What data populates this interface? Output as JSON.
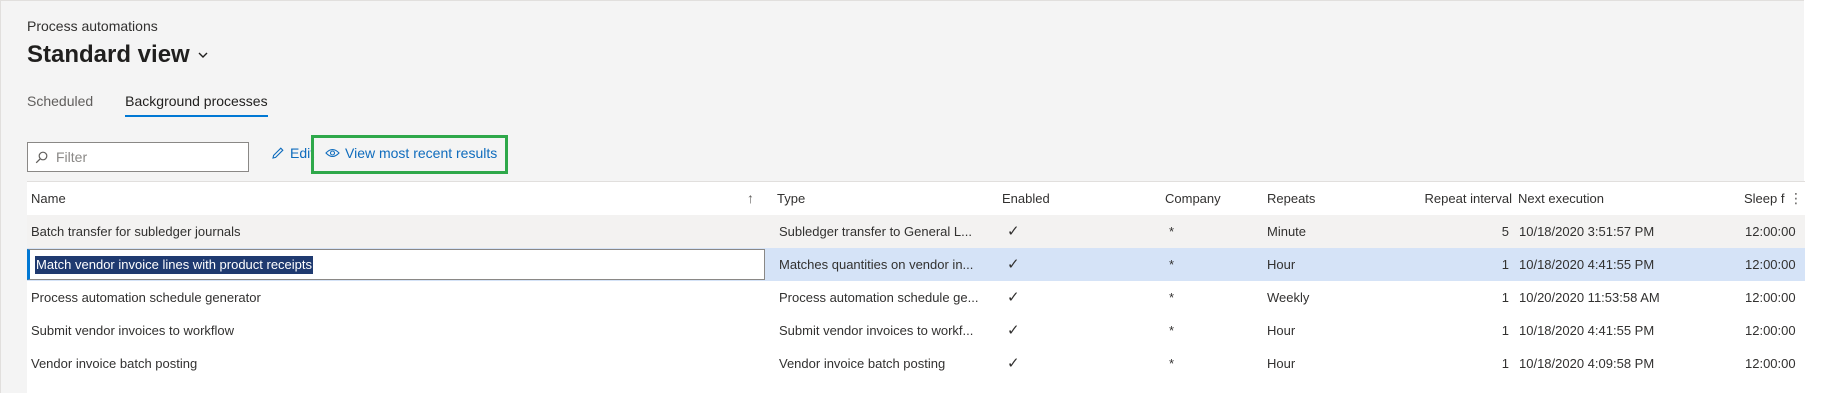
{
  "header": {
    "caption": "Process automations",
    "view_name": "Standard view"
  },
  "tabs": [
    {
      "label": "Scheduled",
      "active": false
    },
    {
      "label": "Background processes",
      "active": true
    }
  ],
  "toolbar": {
    "filter_placeholder": "Filter",
    "edit_label": "Edit",
    "view_results_label": "View most recent results"
  },
  "colors": {
    "accent": "#0078d4",
    "highlight_box": "#2ea84a",
    "check": "#107c10",
    "selected_row": "#d5e3f7"
  },
  "grid": {
    "columns": [
      "Name",
      "Type",
      "Enabled",
      "Company",
      "Repeats",
      "Repeat interval",
      "Next execution",
      "Sleep f"
    ],
    "sort_indicator": "↑",
    "rows": [
      {
        "name": "Batch transfer for subledger journals",
        "type": "Subledger transfer to General L...",
        "enabled": "✓",
        "company": "*",
        "repeats": "Minute",
        "interval": "5",
        "next": "10/18/2020 3:51:57 PM",
        "sleep": "12:00:00"
      },
      {
        "name": "Match vendor invoice lines with product receipts",
        "type": "Matches quantities on vendor in...",
        "enabled": "✓",
        "company": "*",
        "repeats": "Hour",
        "interval": "1",
        "next": "10/18/2020 4:41:55 PM",
        "sleep": "12:00:00"
      },
      {
        "name": "Process automation schedule generator",
        "type": "Process automation schedule ge...",
        "enabled": "✓",
        "company": "*",
        "repeats": "Weekly",
        "interval": "1",
        "next": "10/20/2020 11:53:58 AM",
        "sleep": "12:00:00"
      },
      {
        "name": "Submit vendor invoices to workflow",
        "type": "Submit vendor invoices to workf...",
        "enabled": "✓",
        "company": "*",
        "repeats": "Hour",
        "interval": "1",
        "next": "10/18/2020 4:41:55 PM",
        "sleep": "12:00:00"
      },
      {
        "name": "Vendor invoice batch posting",
        "type": "Vendor invoice batch posting",
        "enabled": "✓",
        "company": "*",
        "repeats": "Hour",
        "interval": "1",
        "next": "10/18/2020 4:09:58 PM",
        "sleep": "12:00:00"
      }
    ]
  }
}
